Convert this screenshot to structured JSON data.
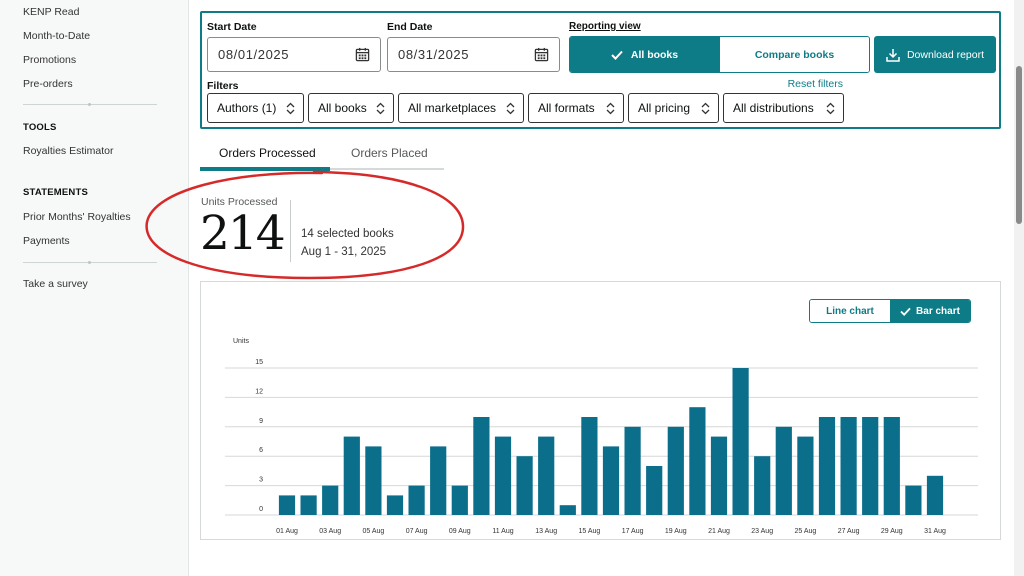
{
  "sidebar": {
    "items_top": [
      "KENP Read",
      "Month-to-Date",
      "Promotions",
      "Pre-orders"
    ],
    "tools_heading": "TOOLS",
    "tools_items": [
      "Royalties Estimator"
    ],
    "statements_heading": "STATEMENTS",
    "statements_items": [
      "Prior Months' Royalties",
      "Payments"
    ],
    "survey": "Take a survey"
  },
  "filters_panel": {
    "start_date_label": "Start Date",
    "start_date": "08/01/2025",
    "end_date_label": "End Date",
    "end_date": "08/31/2025",
    "reporting_view_label": "Reporting view",
    "view_all_books": "All books",
    "view_compare_books": "Compare books",
    "download_label": "Download report",
    "filters_label": "Filters",
    "reset_filters": "Reset filters",
    "dropdowns": [
      "Authors (1)",
      "All books",
      "All marketplaces",
      "All formats",
      "All pricing",
      "All distributions"
    ]
  },
  "tabs": {
    "active": "Orders Processed",
    "inactive": "Orders Placed"
  },
  "summary": {
    "label": "Units Processed",
    "value": "214",
    "books": "14 selected books",
    "range": "Aug 1 - 31, 2025"
  },
  "chart_toggle": {
    "line": "Line chart",
    "bar": "Bar chart"
  },
  "colors": {
    "accent": "#0e7c86",
    "bar": "#0b6e8b",
    "annotation": "#d62a2a"
  },
  "chart_data": {
    "type": "bar",
    "ylabel": "Units",
    "ylim": [
      0,
      15
    ],
    "yticks": [
      0,
      3,
      6,
      9,
      12,
      15
    ],
    "categories": [
      "01 Aug",
      "02 Aug",
      "03 Aug",
      "04 Aug",
      "05 Aug",
      "06 Aug",
      "07 Aug",
      "08 Aug",
      "09 Aug",
      "10 Aug",
      "11 Aug",
      "12 Aug",
      "13 Aug",
      "14 Aug",
      "15 Aug",
      "16 Aug",
      "17 Aug",
      "18 Aug",
      "19 Aug",
      "20 Aug",
      "21 Aug",
      "22 Aug",
      "23 Aug",
      "24 Aug",
      "25 Aug",
      "26 Aug",
      "27 Aug",
      "28 Aug",
      "29 Aug",
      "30 Aug",
      "31 Aug"
    ],
    "values": [
      2,
      2,
      3,
      8,
      7,
      2,
      3,
      7,
      3,
      10,
      8,
      6,
      8,
      1,
      10,
      7,
      9,
      5,
      9,
      11,
      8,
      15,
      6,
      9,
      8,
      10,
      10,
      10,
      10,
      3,
      4
    ],
    "grid": true,
    "legend": "none"
  }
}
